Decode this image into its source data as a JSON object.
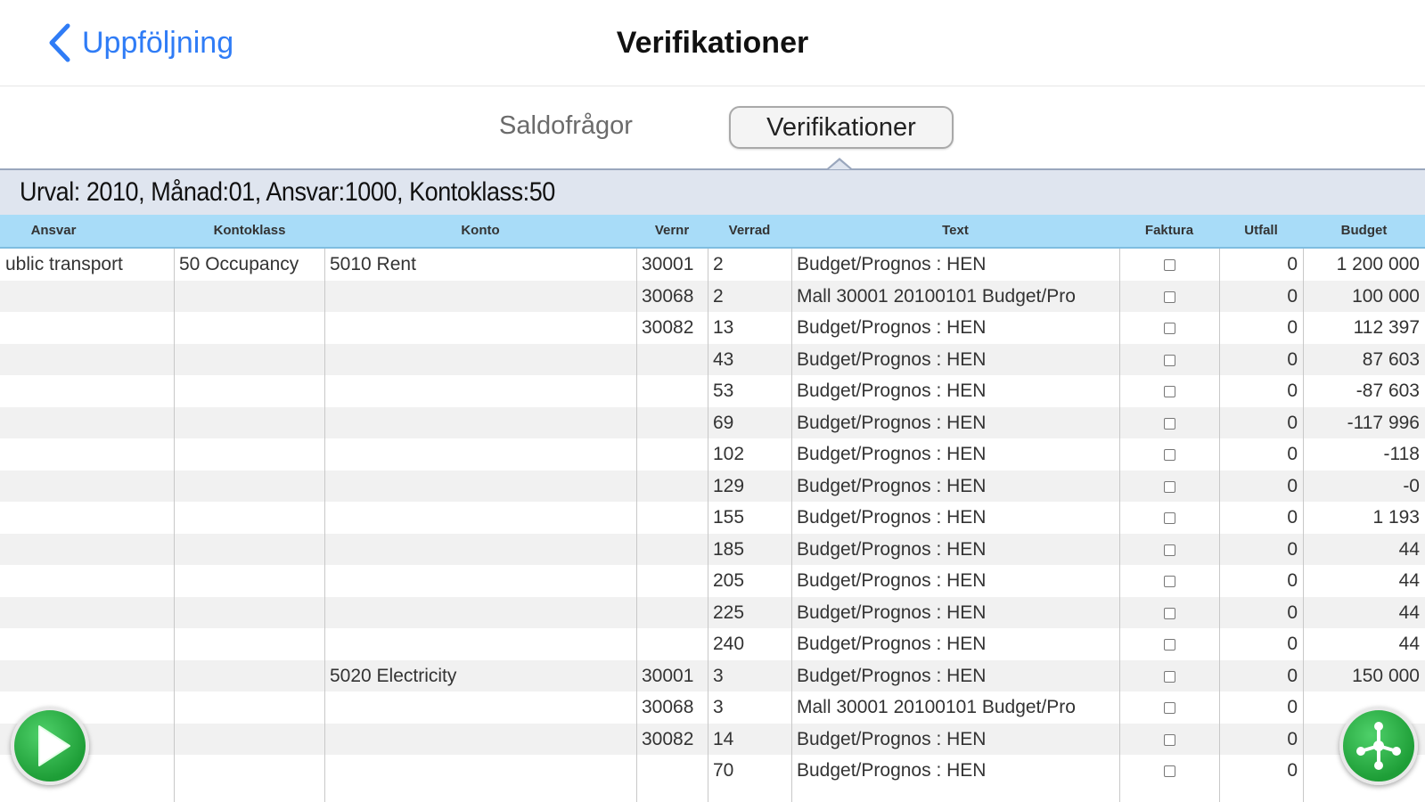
{
  "nav": {
    "back_label": "Uppföljning",
    "title": "Verifikationer"
  },
  "segments": [
    {
      "label": "Saldofrågor",
      "selected": false
    },
    {
      "label": "Verifikationer",
      "selected": true
    }
  ],
  "selection_text": "Urval: 2010, Månad:01, Ansvar:1000, Kontoklass:50",
  "columns": [
    "Ansvar",
    "Kontoklass",
    "Konto",
    "Vernr",
    "Verrad",
    "Text",
    "Faktura",
    "Utfall",
    "Budget"
  ],
  "rows": [
    {
      "ansvar": "ublic transport",
      "kontoklass": "50 Occupancy",
      "konto": "5010 Rent",
      "vernr": "30001",
      "verrad": "2",
      "text": "Budget/Prognos : HEN",
      "utfall": "0",
      "budget": "1 200 000"
    },
    {
      "ansvar": "",
      "kontoklass": "",
      "konto": "",
      "vernr": "30068",
      "verrad": "2",
      "text": "Mall 30001 20100101 Budget/Pro",
      "utfall": "0",
      "budget": "100 000"
    },
    {
      "ansvar": "",
      "kontoklass": "",
      "konto": "",
      "vernr": "30082",
      "verrad": "13",
      "text": "Budget/Prognos : HEN",
      "utfall": "0",
      "budget": "112 397"
    },
    {
      "ansvar": "",
      "kontoklass": "",
      "konto": "",
      "vernr": "",
      "verrad": "43",
      "text": "Budget/Prognos : HEN",
      "utfall": "0",
      "budget": "87 603"
    },
    {
      "ansvar": "",
      "kontoklass": "",
      "konto": "",
      "vernr": "",
      "verrad": "53",
      "text": "Budget/Prognos : HEN",
      "utfall": "0",
      "budget": "-87 603"
    },
    {
      "ansvar": "",
      "kontoklass": "",
      "konto": "",
      "vernr": "",
      "verrad": "69",
      "text": "Budget/Prognos : HEN",
      "utfall": "0",
      "budget": "-117 996"
    },
    {
      "ansvar": "",
      "kontoklass": "",
      "konto": "",
      "vernr": "",
      "verrad": "102",
      "text": "Budget/Prognos : HEN",
      "utfall": "0",
      "budget": "-118"
    },
    {
      "ansvar": "",
      "kontoklass": "",
      "konto": "",
      "vernr": "",
      "verrad": "129",
      "text": "Budget/Prognos : HEN",
      "utfall": "0",
      "budget": "-0"
    },
    {
      "ansvar": "",
      "kontoklass": "",
      "konto": "",
      "vernr": "",
      "verrad": "155",
      "text": "Budget/Prognos : HEN",
      "utfall": "0",
      "budget": "1 193"
    },
    {
      "ansvar": "",
      "kontoklass": "",
      "konto": "",
      "vernr": "",
      "verrad": "185",
      "text": "Budget/Prognos : HEN",
      "utfall": "0",
      "budget": "44"
    },
    {
      "ansvar": "",
      "kontoklass": "",
      "konto": "",
      "vernr": "",
      "verrad": "205",
      "text": "Budget/Prognos : HEN",
      "utfall": "0",
      "budget": "44"
    },
    {
      "ansvar": "",
      "kontoklass": "",
      "konto": "",
      "vernr": "",
      "verrad": "225",
      "text": "Budget/Prognos : HEN",
      "utfall": "0",
      "budget": "44"
    },
    {
      "ansvar": "",
      "kontoklass": "",
      "konto": "",
      "vernr": "",
      "verrad": "240",
      "text": "Budget/Prognos : HEN",
      "utfall": "0",
      "budget": "44"
    },
    {
      "ansvar": "",
      "kontoklass": "",
      "konto": "5020 Electricity",
      "vernr": "30001",
      "verrad": "3",
      "text": "Budget/Prognos : HEN",
      "utfall": "0",
      "budget": "150 000"
    },
    {
      "ansvar": "",
      "kontoklass": "",
      "konto": "",
      "vernr": "30068",
      "verrad": "3",
      "text": "Mall 30001 20100101 Budget/Pro",
      "utfall": "0",
      "budget": ""
    },
    {
      "ansvar": "",
      "kontoklass": "",
      "konto": "",
      "vernr": "30082",
      "verrad": "14",
      "text": "Budget/Prognos : HEN",
      "utfall": "0",
      "budget": ""
    },
    {
      "ansvar": "",
      "kontoklass": "",
      "konto": "",
      "vernr": "",
      "verrad": "70",
      "text": "Budget/Prognos : HEN",
      "utfall": "0",
      "budget": ""
    }
  ],
  "icons": {
    "back": "chevron-left-icon",
    "play": "play-icon",
    "share": "share-icon"
  },
  "colors": {
    "accent": "#2f7cf6",
    "header_bg": "#a8dcf8",
    "urval_bg": "#dfe5ef",
    "fab_green": "#1e9e37"
  }
}
